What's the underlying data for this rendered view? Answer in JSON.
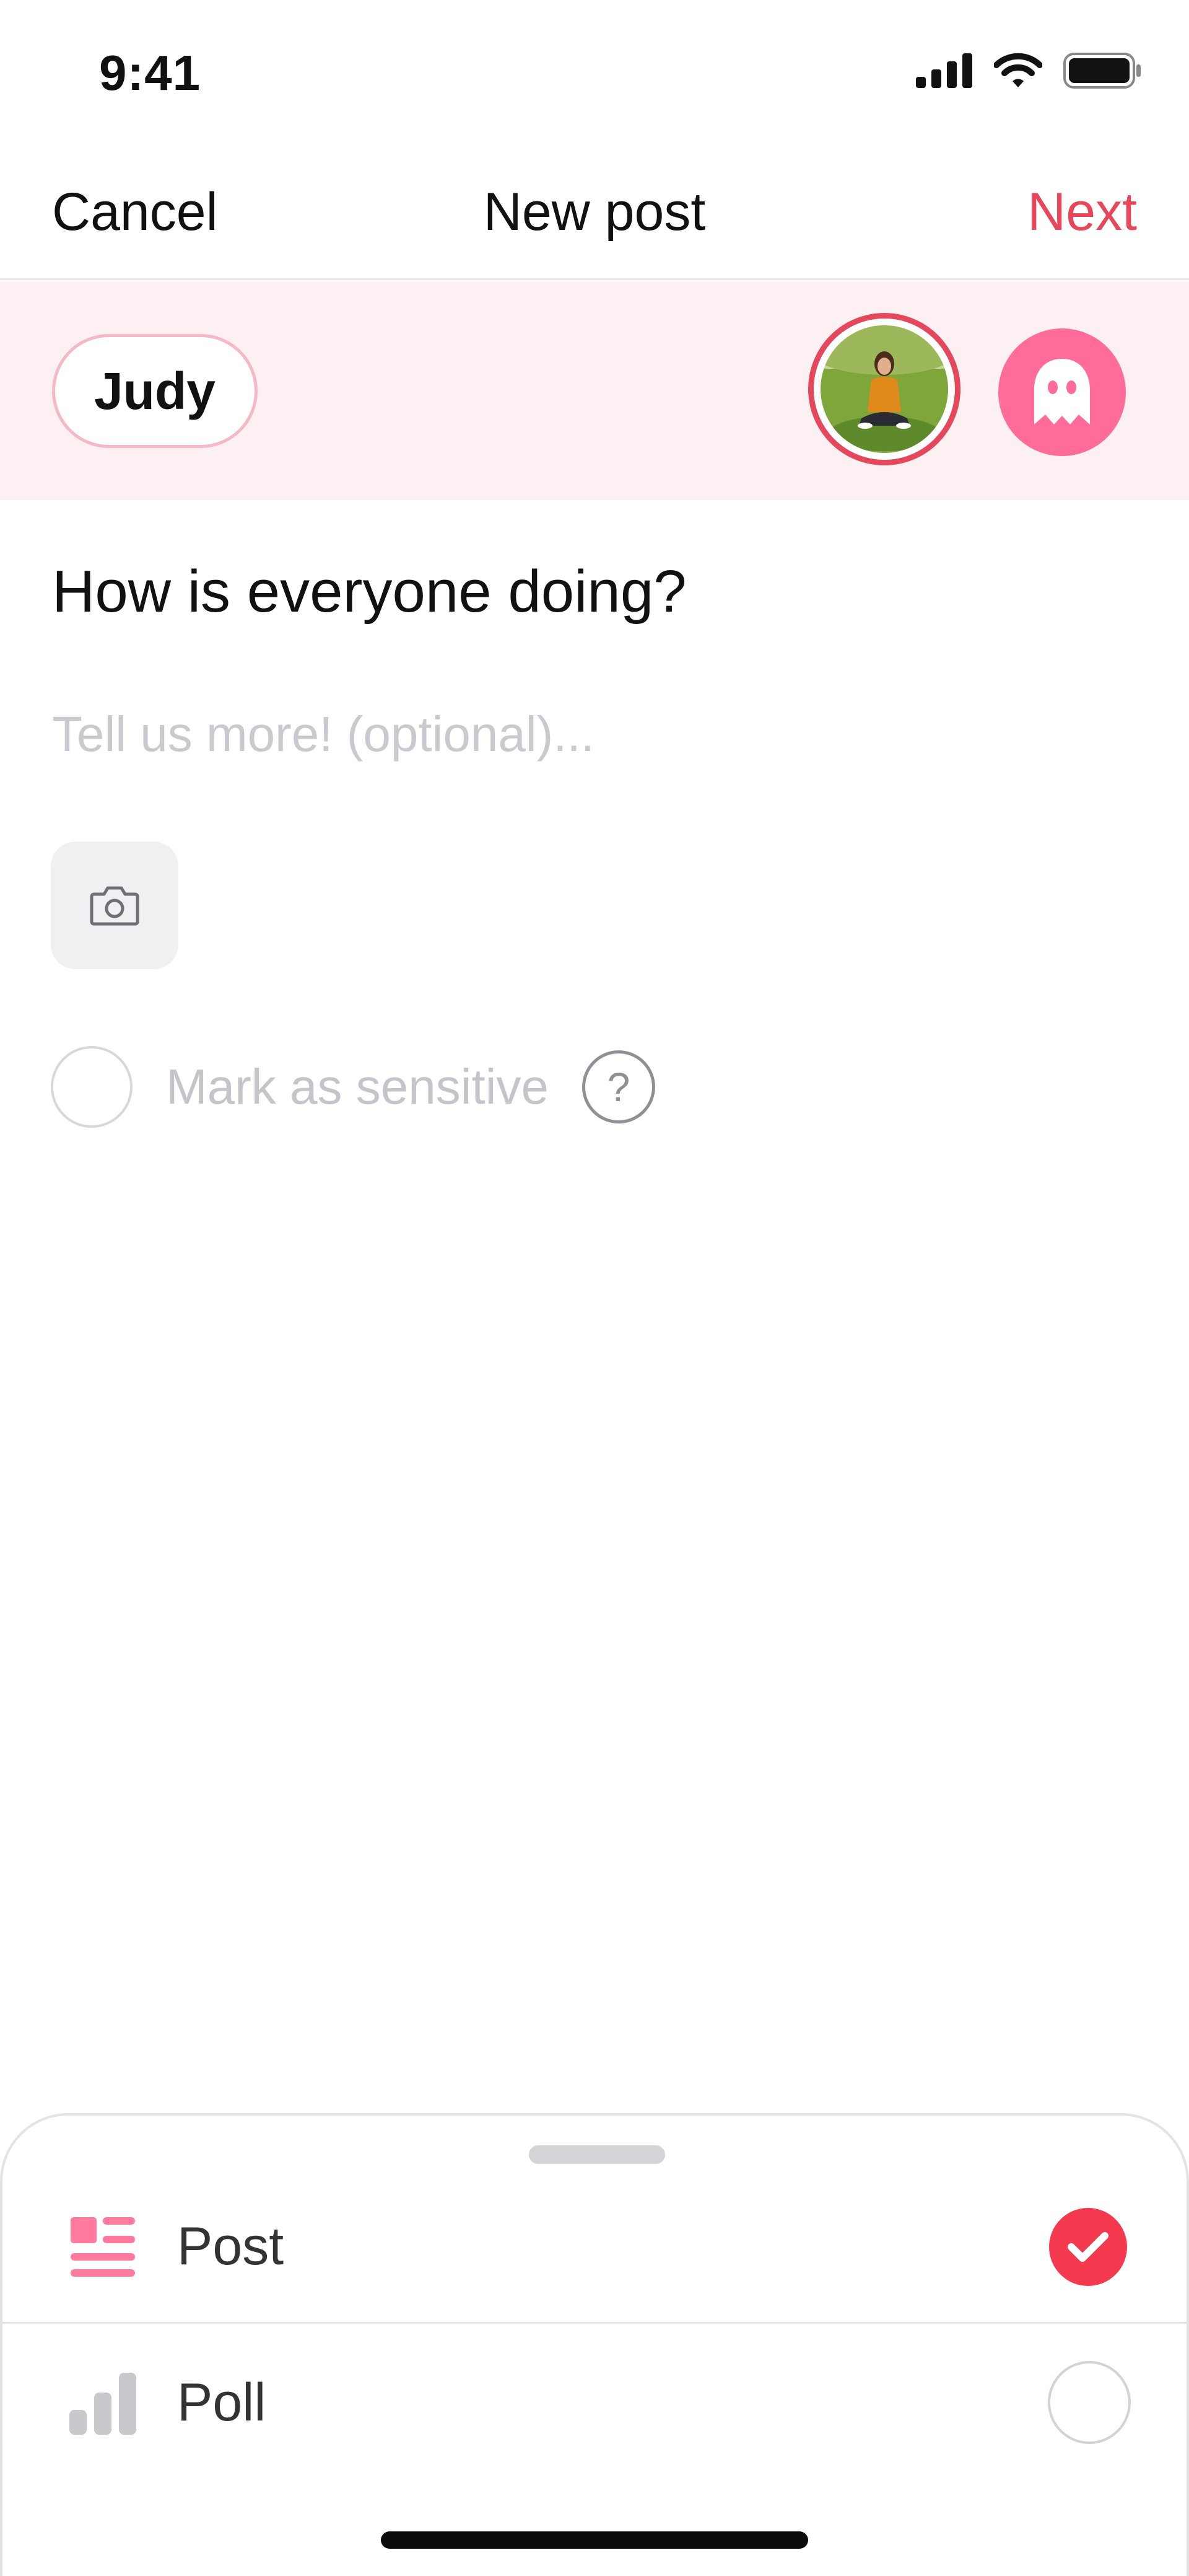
{
  "status_bar": {
    "time": "9:41",
    "icons": [
      "cellular-signal-icon",
      "wifi-icon",
      "battery-icon"
    ]
  },
  "nav": {
    "cancel_label": "Cancel",
    "title": "New post",
    "next_label": "Next",
    "accent_color": "#e8465b"
  },
  "identity": {
    "selected_name": "Judy",
    "avatar_icon": "user-photo-avatar",
    "anonymous_icon": "ghost-icon",
    "strip_color": "#fdf0f3"
  },
  "compose": {
    "title_value": "How is everyone doing?",
    "body_placeholder": "Tell us more! (optional)...",
    "camera_icon": "camera-icon",
    "sensitive_label": "Mark as sensitive",
    "help_symbol": "?"
  },
  "post_types": {
    "items": [
      {
        "label": "Post",
        "icon": "post-list-icon",
        "selected": true
      },
      {
        "label": "Poll",
        "icon": "poll-bars-icon",
        "selected": false
      }
    ],
    "check_color": "#f4394f"
  }
}
